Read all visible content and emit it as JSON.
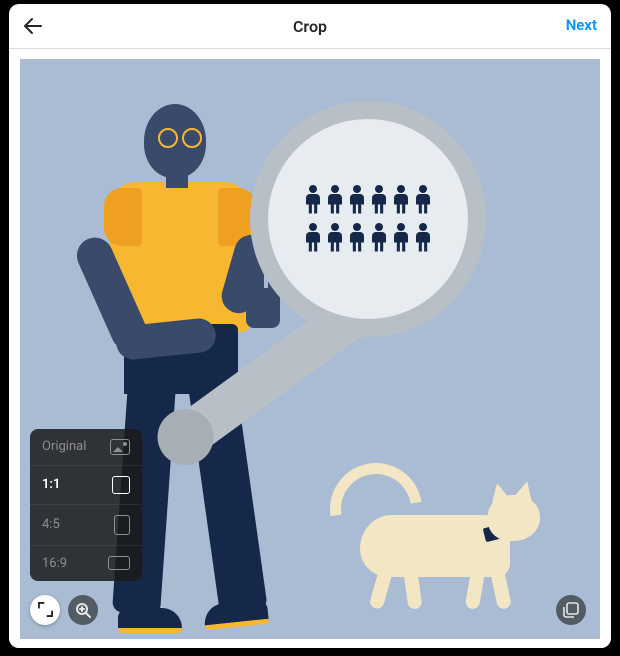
{
  "header": {
    "title": "Crop",
    "next_label": "Next",
    "back_icon": "arrow-left"
  },
  "ratio_menu": {
    "items": [
      {
        "label": "Original",
        "shape": "orig",
        "selected": false
      },
      {
        "label": "1:1",
        "shape": "sq",
        "selected": true
      },
      {
        "label": "4:5",
        "shape": "rt45",
        "selected": false
      },
      {
        "label": "16:9",
        "shape": "rt169",
        "selected": false
      }
    ]
  },
  "controls": {
    "crop_icon": "expand",
    "zoom_icon": "magnify",
    "gallery_icon": "layers"
  },
  "illustration": {
    "people_rows": [
      6,
      6
    ],
    "accent": "#f7b731",
    "skin": "#3a4a6b",
    "pants": "#16284a",
    "bg": "#a9bcd3",
    "cat": "#f3e6c4"
  }
}
